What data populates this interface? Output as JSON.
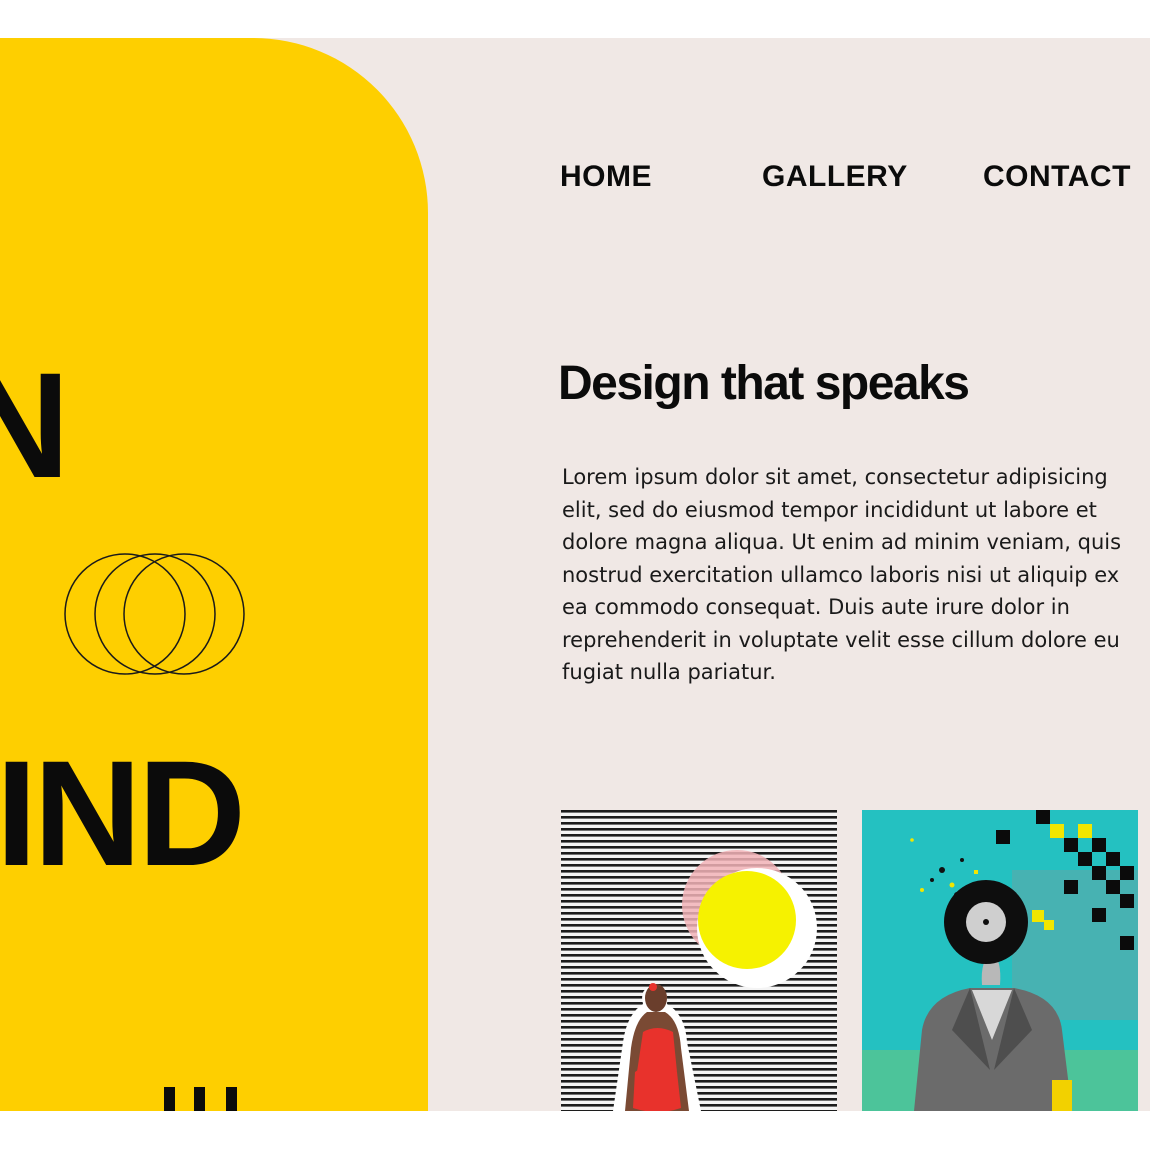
{
  "hero": {
    "word_top": "N",
    "word_middle": "IND"
  },
  "nav": {
    "items": [
      {
        "label": "HOME"
      },
      {
        "label": "GALLERY"
      },
      {
        "label": "CONTACT"
      }
    ]
  },
  "main": {
    "headline": "Design that speaks",
    "paragraph": "Lorem ipsum dolor sit amet, consectetur adipisicing elit, sed do eiusmod tempor incididunt ut labore et dolore magna aliqua. Ut enim ad minim veniam, quis nostrud exercitation ullamco laboris nisi ut aliquip ex ea commodo consequat. Duis aute irure dolor in reprehenderit in voluptate velit esse cillum dolore eu fugiat nulla pariatur."
  },
  "gallery": {
    "cards": [
      {
        "icon": "striped-sunset-collage-image"
      },
      {
        "icon": "record-head-collage-image"
      }
    ]
  },
  "colors": {
    "page_background": "#f0e8e5",
    "accent_yellow": "#fecf00",
    "text_dark": "#0b0b0b",
    "card_teal": "#1fbdbd"
  }
}
